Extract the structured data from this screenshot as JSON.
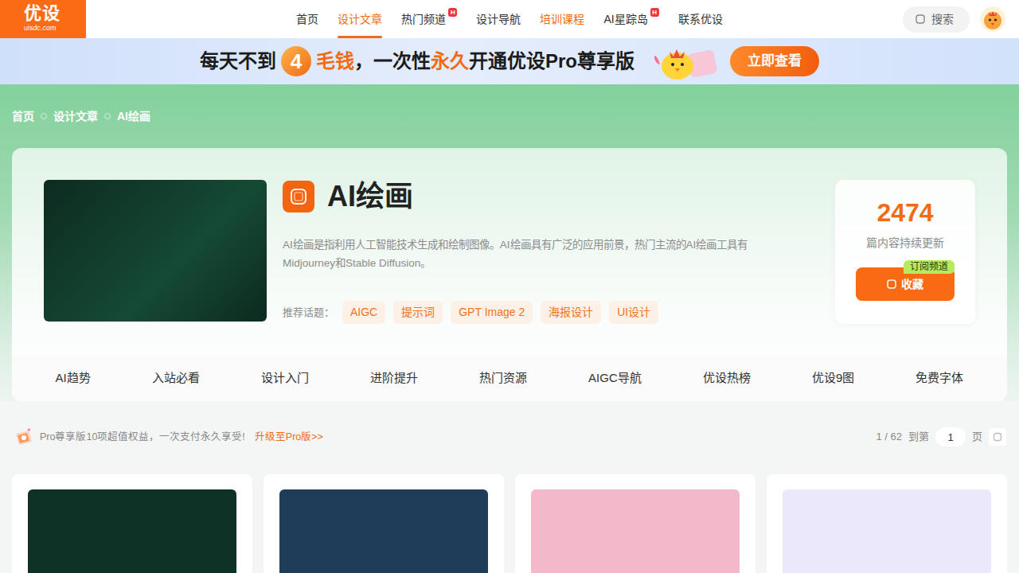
{
  "logo": {
    "name": "优设",
    "domain": "uisdc.com"
  },
  "nav": [
    {
      "label": "首页",
      "selected": false,
      "kind": "plain"
    },
    {
      "label": "设计文章",
      "selected": true,
      "kind": "plain"
    },
    {
      "label": "热门频道",
      "selected": false,
      "kind": "plain",
      "badge": "H"
    },
    {
      "label": "设计导航",
      "selected": false,
      "kind": "plain"
    },
    {
      "label": "培训课程",
      "selected": false,
      "kind": "accent"
    },
    {
      "label": "AI星踪岛",
      "selected": false,
      "kind": "plain",
      "badge": "H"
    },
    {
      "label": "联系优设",
      "selected": false,
      "kind": "plain"
    }
  ],
  "search": {
    "label": "搜索"
  },
  "banner": {
    "parts": [
      {
        "text": "每天不到",
        "kind": "plain"
      },
      {
        "text": "4",
        "kind": "circle"
      },
      {
        "text": "毛钱",
        "kind": "accent"
      },
      {
        "text": "，一次性",
        "kind": "plain"
      },
      {
        "text": "永久",
        "kind": "accent"
      },
      {
        "text": "开通优设Pro尊享版",
        "kind": "plain"
      }
    ],
    "button": "立即查看"
  },
  "breadcrumb": [
    "首页",
    "设计文章",
    "AI绘画"
  ],
  "channel": {
    "title": "AI绘画",
    "description": "AI绘画是指利用人工智能技术生成和绘制图像。AI绘画具有广泛的应用前景，热门主流的AI绘画工具有Midjourney和Stable Diffusion。",
    "topics_label": "推荐话题：",
    "topics": [
      "AIGC",
      "提示词",
      "GPT Image 2",
      "海报设计",
      "UI设计"
    ],
    "count": "2474",
    "count_label": "篇内容持续更新",
    "subscribe": "订阅频道",
    "favorite": "收藏"
  },
  "subnav": [
    "AI趋势",
    "入站必看",
    "设计入门",
    "进阶提升",
    "热门资源",
    "AIGC导航",
    "优设热榜",
    "优设9图",
    "免费字体"
  ],
  "promo": {
    "text": "Pro尊享版10项超值权益，一次支付永久享受!",
    "link": "升级至Pro版>>"
  },
  "pager": {
    "position": "1 / 62",
    "goto": "到第",
    "value": "1",
    "unit": "页"
  },
  "articles": [
    {
      "color": "#0f3226"
    },
    {
      "color": "#1f3d58"
    },
    {
      "color": "#f3b9cb"
    },
    {
      "color": "#ece8fb"
    }
  ]
}
